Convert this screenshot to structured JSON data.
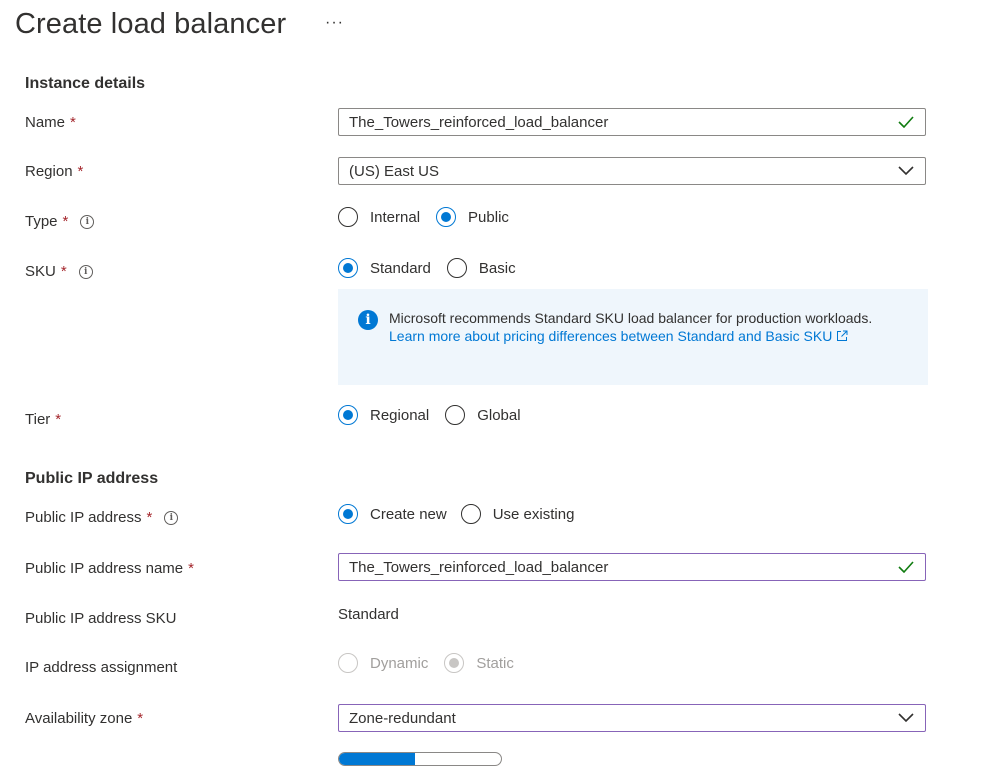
{
  "header": {
    "title": "Create load balancer",
    "more_label": "···"
  },
  "instance": {
    "section_title": "Instance details",
    "name": {
      "label": "Name",
      "required": "*",
      "value": "The_Towers_reinforced_load_balancer"
    },
    "region": {
      "label": "Region",
      "required": "*",
      "value": "(US) East US"
    },
    "type": {
      "label": "Type",
      "required": "*",
      "options": [
        "Internal",
        "Public"
      ],
      "selected": "Public"
    },
    "sku": {
      "label": "SKU",
      "required": "*",
      "options": [
        "Standard",
        "Basic"
      ],
      "selected": "Standard"
    },
    "info": {
      "message": "Microsoft recommends Standard SKU load balancer for production workloads.",
      "link_text": "Learn more about pricing differences between Standard and Basic SKU"
    },
    "tier": {
      "label": "Tier",
      "required": "*",
      "options": [
        "Regional",
        "Global"
      ],
      "selected": "Regional"
    }
  },
  "public_ip": {
    "section_title": "Public IP address",
    "mode": {
      "label": "Public IP address",
      "required": "*",
      "options": [
        "Create new",
        "Use existing"
      ],
      "selected": "Create new"
    },
    "name": {
      "label": "Public IP address name",
      "required": "*",
      "value": "The_Towers_reinforced_load_balancer"
    },
    "sku": {
      "label": "Public IP address SKU",
      "value": "Standard"
    },
    "assignment": {
      "label": "IP address assignment",
      "options": [
        "Dynamic",
        "Static"
      ],
      "selected": "Static",
      "disabled": true
    },
    "zone": {
      "label": "Availability zone",
      "required": "*",
      "value": "Zone-redundant"
    }
  },
  "colors": {
    "accent": "#0078d4",
    "required": "#a4262c",
    "valid": "#107c10",
    "focus_border": "#8764b8",
    "info_bg": "#eff6fc"
  },
  "icons": [
    "checkmark-icon",
    "chevron-down-icon",
    "info-icon",
    "external-link-icon"
  ]
}
